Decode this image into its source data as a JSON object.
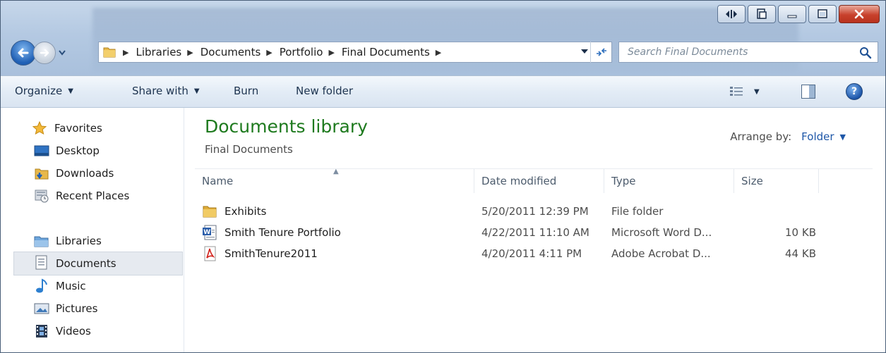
{
  "address": {
    "crumbs": [
      "Libraries",
      "Documents",
      "Portfolio",
      "Final Documents"
    ]
  },
  "search": {
    "placeholder": "Search Final Documents"
  },
  "toolbar": {
    "organize": "Organize",
    "share_with": "Share with",
    "burn": "Burn",
    "new_folder": "New folder"
  },
  "sidebar": {
    "favorites": {
      "label": "Favorites",
      "items": [
        {
          "label": "Desktop",
          "icon": "desktop-icon"
        },
        {
          "label": "Downloads",
          "icon": "downloads-folder-icon"
        },
        {
          "label": "Recent Places",
          "icon": "recent-places-icon"
        }
      ]
    },
    "libraries": {
      "label": "Libraries",
      "items": [
        {
          "label": "Documents",
          "icon": "documents-icon",
          "selected": true
        },
        {
          "label": "Music",
          "icon": "music-note-icon"
        },
        {
          "label": "Pictures",
          "icon": "pictures-icon"
        },
        {
          "label": "Videos",
          "icon": "film-icon"
        }
      ]
    }
  },
  "main": {
    "title": "Documents library",
    "subtitle": "Final Documents",
    "arrange_label": "Arrange by:",
    "arrange_value": "Folder",
    "columns": {
      "name": "Name",
      "date": "Date modified",
      "type": "Type",
      "size": "Size"
    },
    "files": [
      {
        "name": "Exhibits",
        "date": "5/20/2011 12:39 PM",
        "type": "File folder",
        "size": "",
        "icon": "folder-icon"
      },
      {
        "name": "Smith Tenure Portfolio",
        "date": "4/22/2011 11:10 AM",
        "type": "Microsoft Word D...",
        "size": "10 KB",
        "icon": "word-document-icon"
      },
      {
        "name": "SmithTenure2011",
        "date": "4/20/2011 4:11 PM",
        "type": "Adobe Acrobat D...",
        "size": "44 KB",
        "icon": "pdf-icon"
      }
    ]
  },
  "colors": {
    "title_green": "#1e7a1e",
    "link_blue": "#1e57a8",
    "chrome_blue": "#b4c9e2",
    "close_red": "#c8412c"
  }
}
